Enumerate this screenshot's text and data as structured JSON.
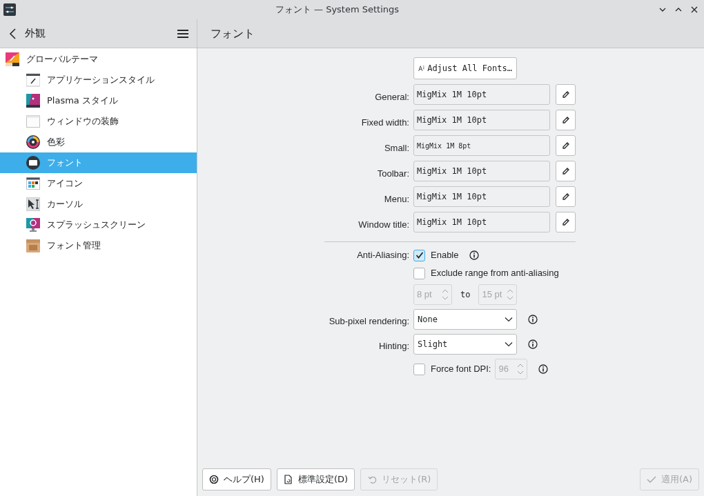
{
  "window": {
    "title": "フォント — System Settings"
  },
  "sidebar": {
    "title": "外観",
    "items": [
      {
        "label": "グローバルテーマ",
        "selected": false,
        "children": [
          {
            "label": "アプリケーションスタイル",
            "selected": false
          },
          {
            "label": "Plasma スタイル",
            "selected": false
          },
          {
            "label": "ウィンドウの装飾",
            "selected": false
          },
          {
            "label": "色彩",
            "selected": false
          },
          {
            "label": "フォント",
            "selected": true
          },
          {
            "label": "アイコン",
            "selected": false
          },
          {
            "label": "カーソル",
            "selected": false
          },
          {
            "label": "スプラッシュスクリーン",
            "selected": false
          },
          {
            "label": "フォント管理",
            "selected": false
          }
        ]
      }
    ]
  },
  "page_title": "フォント",
  "adjust_button": "Adjust All Fonts…",
  "fonts": [
    {
      "label": "General:",
      "value": "MigMix 1M 10pt",
      "kind": "normal"
    },
    {
      "label": "Fixed width:",
      "value": "MigMix 1M 10pt",
      "kind": "normal"
    },
    {
      "label": "Small:",
      "value": "MigMix 1M 8pt",
      "kind": "small"
    },
    {
      "label": "Toolbar:",
      "value": "MigMix 1M 10pt",
      "kind": "normal"
    },
    {
      "label": "Menu:",
      "value": "MigMix 1M 10pt",
      "kind": "normal"
    },
    {
      "label": "Window title:",
      "value": "MigMix 1M 10pt",
      "kind": "normal"
    }
  ],
  "anti_aliasing": {
    "label": "Anti-Aliasing:",
    "enable": {
      "label": "Enable",
      "checked": true
    },
    "exclude": {
      "label": "Exclude range from anti-aliasing",
      "checked": false
    },
    "range": {
      "from": "8 pt",
      "to_label": "to",
      "to": "15 pt",
      "disabled": true
    }
  },
  "sub_pixel": {
    "label": "Sub-pixel rendering:",
    "value": "None"
  },
  "hinting": {
    "label": "Hinting:",
    "value": "Slight"
  },
  "force_dpi": {
    "label": "Force font DPI:",
    "checked": false,
    "value": "96",
    "disabled": true
  },
  "footer": {
    "left": [
      {
        "label": "ヘルプ(H)",
        "disabled": false
      },
      {
        "label": "標準設定(D)",
        "disabled": false
      },
      {
        "label": "リセット(R)",
        "disabled": true
      }
    ],
    "right": [
      {
        "label": "適用(A)",
        "disabled": true
      }
    ]
  }
}
